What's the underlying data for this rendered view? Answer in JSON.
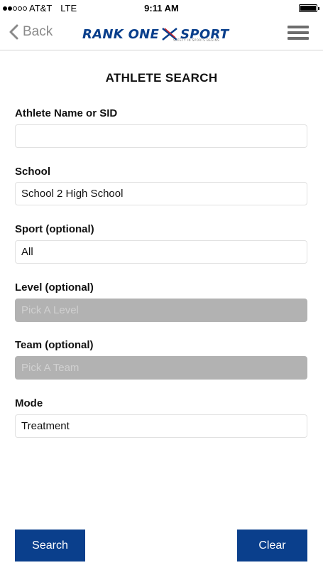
{
  "status_bar": {
    "carrier": "AT&T",
    "network": "LTE",
    "time": "9:11 AM",
    "signal_bars_filled": 2,
    "signal_bars_total": 5
  },
  "nav": {
    "back_label": "Back",
    "logo_text_left": "RANK ONE",
    "logo_text_right": "SPORT",
    "logo_tagline": "SAFETY IN SPORTS BEGINS",
    "menu_icon": "hamburger-menu-icon"
  },
  "page": {
    "title": "ATHLETE SEARCH"
  },
  "form": {
    "athlete": {
      "label": "Athlete Name or SID",
      "value": "",
      "placeholder": ""
    },
    "school": {
      "label": "School",
      "value": "School 2 High School"
    },
    "sport": {
      "label": "Sport (optional)",
      "value": "All"
    },
    "level": {
      "label": "Level (optional)",
      "placeholder": "Pick A Level"
    },
    "team": {
      "label": "Team (optional)",
      "placeholder": "Pick A Team"
    },
    "mode": {
      "label": "Mode",
      "value": "Treatment"
    }
  },
  "buttons": {
    "search": "Search",
    "clear": "Clear"
  },
  "colors": {
    "brand_blue": "#0a3f8c",
    "disabled_field": "#b2b2b2"
  }
}
